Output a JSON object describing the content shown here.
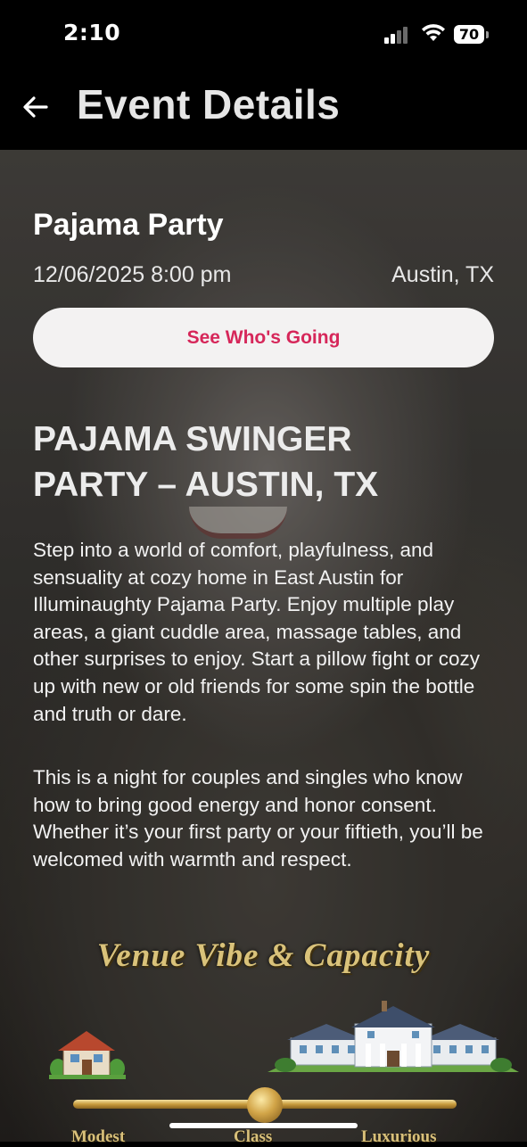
{
  "status_bar": {
    "time": "2:10",
    "battery": "70",
    "icons": [
      "cellular-signal-icon",
      "wifi-icon",
      "battery-icon"
    ]
  },
  "header": {
    "back_icon": "arrow-left-icon",
    "title": "Event Details"
  },
  "event": {
    "name": "Pajama Party",
    "datetime": "12/06/2025 8:00 pm",
    "location": "Austin, TX",
    "whos_going_label": "See Who's Going"
  },
  "description": {
    "headline": " PAJAMA SWINGER\nPARTY – AUSTIN, TX",
    "paragraphs": [
      "Step into a world of comfort, playfulness, and sensuality at cozy home in East Austin for Illuminaughty Pajama Party. Enjoy multiple play areas, a giant cuddle area, massage tables, and other surprises to enjoy. Start a pillow fight or cozy up with new or old friends for some spin the bottle and truth or dare.",
      "This is a night for couples and singles who know how to bring good energy and honor consent. Whether it’s your first party or your fiftieth, you’ll be welcomed with warmth and respect."
    ]
  },
  "venue_banner": {
    "title": "Venue Vibe & Capacity",
    "scale_labels": [
      "Modest",
      "Class",
      "Luxurious"
    ],
    "scale_level": 0.5,
    "icons": [
      "small-house-icon",
      "mansion-icon"
    ]
  },
  "colors": {
    "accent": "#d6275a",
    "button_bg": "#f3f2f2",
    "header_bg": "#000000",
    "gold": "#d9c27a"
  }
}
